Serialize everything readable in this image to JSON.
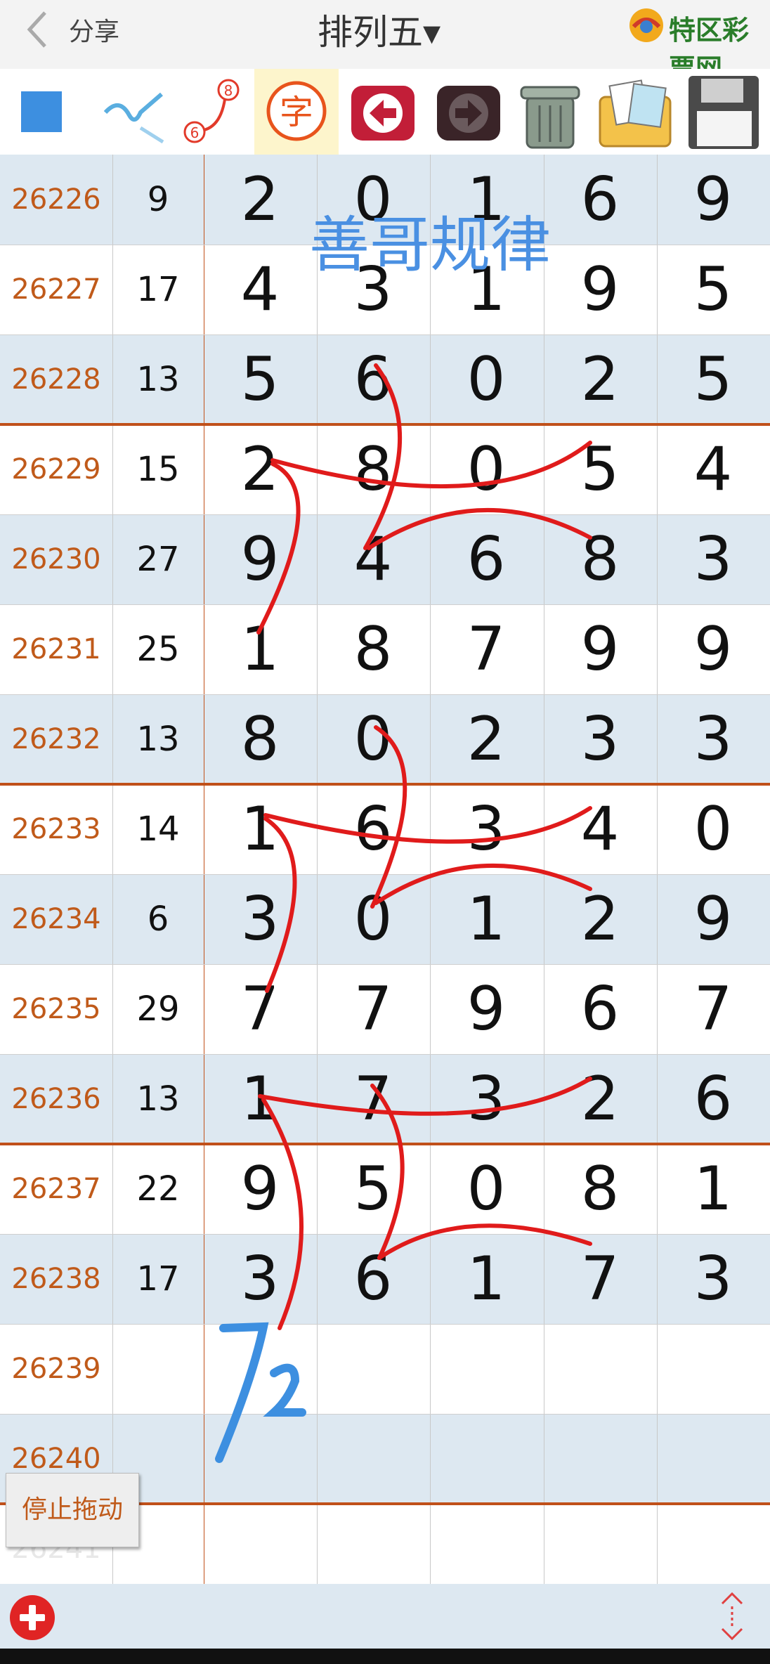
{
  "header": {
    "share_label": "分享",
    "title": "排列五▾",
    "logo_text": "特区彩票网"
  },
  "toolbar": {
    "icons": [
      "blue-square-icon",
      "pen-icon",
      "number-link-icon",
      "text-icon",
      "back-arrow-icon",
      "forward-arrow-icon",
      "trash-icon",
      "gallery-icon",
      "save-disk-icon"
    ],
    "text_icon_glyph": "字",
    "link_icon_numbers": [
      "8",
      "6"
    ]
  },
  "watermark": "善哥规律",
  "rows": [
    {
      "period": "26226",
      "sum": "9",
      "digits": [
        "2",
        "0",
        "1",
        "6",
        "9"
      ]
    },
    {
      "period": "26227",
      "sum": "17",
      "digits": [
        "4",
        "3",
        "1",
        "9",
        "5"
      ]
    },
    {
      "period": "26228",
      "sum": "13",
      "digits": [
        "5",
        "6",
        "0",
        "2",
        "5"
      ]
    },
    {
      "period": "26229",
      "sum": "15",
      "digits": [
        "2",
        "8",
        "0",
        "5",
        "4"
      ]
    },
    {
      "period": "26230",
      "sum": "27",
      "digits": [
        "9",
        "4",
        "6",
        "8",
        "3"
      ]
    },
    {
      "period": "26231",
      "sum": "25",
      "digits": [
        "1",
        "8",
        "7",
        "9",
        "9"
      ]
    },
    {
      "period": "26232",
      "sum": "13",
      "digits": [
        "8",
        "0",
        "2",
        "3",
        "3"
      ]
    },
    {
      "period": "26233",
      "sum": "14",
      "digits": [
        "1",
        "6",
        "3",
        "4",
        "0"
      ]
    },
    {
      "period": "26234",
      "sum": "6",
      "digits": [
        "3",
        "0",
        "1",
        "2",
        "9"
      ]
    },
    {
      "period": "26235",
      "sum": "29",
      "digits": [
        "7",
        "7",
        "9",
        "6",
        "7"
      ]
    },
    {
      "period": "26236",
      "sum": "13",
      "digits": [
        "1",
        "7",
        "3",
        "2",
        "6"
      ]
    },
    {
      "period": "26237",
      "sum": "22",
      "digits": [
        "9",
        "5",
        "0",
        "8",
        "1"
      ]
    },
    {
      "period": "26238",
      "sum": "17",
      "digits": [
        "3",
        "6",
        "1",
        "7",
        "3"
      ]
    },
    {
      "period": "26239",
      "sum": "",
      "digits": [
        "",
        "",
        "",
        "",
        ""
      ]
    },
    {
      "period": "26240",
      "sum": "",
      "digits": [
        "",
        "",
        "",
        "",
        ""
      ]
    },
    {
      "period": "26241",
      "sum": "",
      "digits": [
        "",
        "",
        "",
        "",
        ""
      ]
    }
  ],
  "stop_drag_label": "停止拖动",
  "handwritten_note": "72",
  "colors": {
    "period_text": "#c05a1a",
    "separator": "#c0501a",
    "row_alt": "#dde8f1",
    "annotation_red": "#e01b1b",
    "annotation_blue": "#3d8fe0"
  }
}
